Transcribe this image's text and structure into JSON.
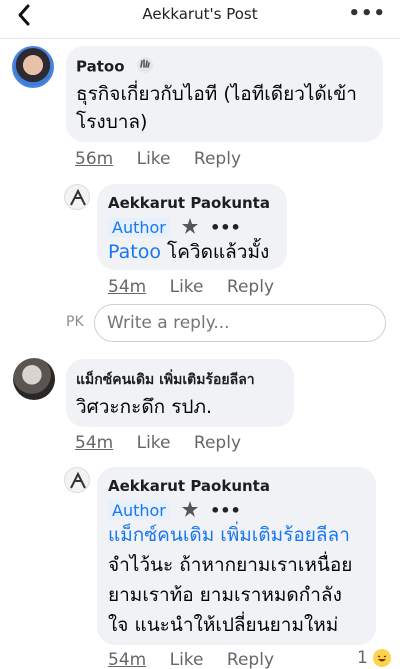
{
  "header": {
    "title": "Aekkarut's Post"
  },
  "comments": [
    {
      "name": "Patoo",
      "text_line1": "ธุรกิจเกี่ยวกับไอที (ไอทีเดียวได้เข้า",
      "text_line2": "โรงบาล)",
      "time": "56m",
      "like": "Like",
      "reply": "Reply"
    },
    {
      "name": "Aekkarut Paokunta",
      "badge": "Author",
      "mention": "Patoo",
      "text": "โควิดแล้วมั้ง",
      "time": "54m",
      "like": "Like",
      "reply": "Reply"
    },
    {
      "name": "แม็กซ์คนเดิม เพิ่มเติมร้อยลีลา",
      "text": "วิศวะกะดึก รปภ.",
      "time": "54m",
      "like": "Like",
      "reply": "Reply"
    },
    {
      "name": "Aekkarut Paokunta",
      "badge": "Author",
      "mention": "แม็กซ์คนเดิม เพิ่มเติมร้อยลีลา",
      "line1": "จำไว้นะ ถ้าหากยามเราเหนื่อย",
      "line2": "ยามเราท้อ ยามเราหมดกำลัง",
      "line3": "ใจ แนะนำให้เปลี่ยนยามใหม่",
      "time": "54m",
      "like": "Like",
      "reply": "Reply",
      "reaction_count": "1"
    }
  ],
  "reply_box": {
    "initials": "PK",
    "placeholder": "Write a reply..."
  }
}
